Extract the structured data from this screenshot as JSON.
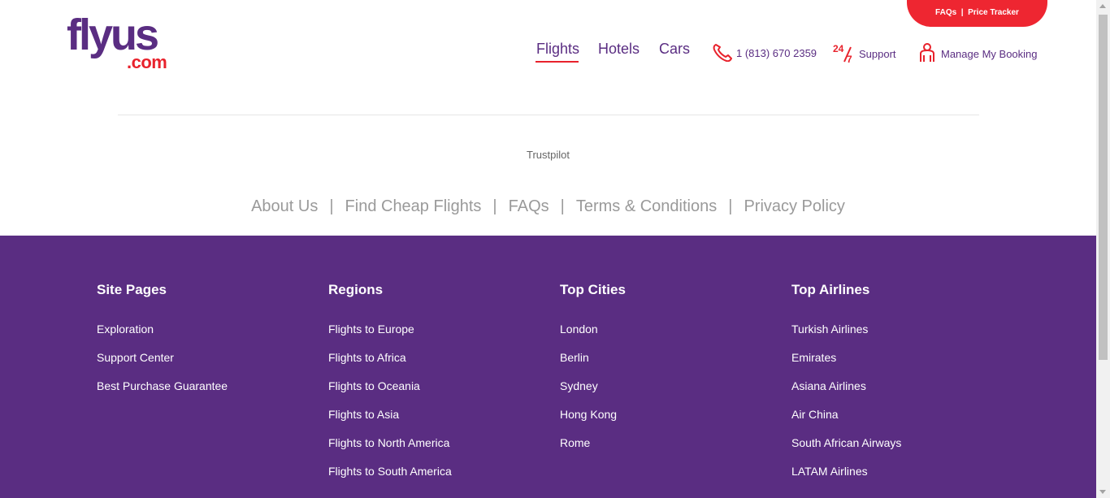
{
  "brand": {
    "logo_main": "flyus",
    "logo_suffix": ".com",
    "primary_color": "#5a2d82",
    "accent_color": "#e8222c"
  },
  "top_pill": {
    "faqs": "FAQs",
    "separator": "|",
    "price_tracker": "Price Tracker"
  },
  "nav": {
    "flights": "Flights",
    "hotels": "Hotels",
    "cars": "Cars",
    "active": "Flights"
  },
  "header": {
    "phone": "1 (813) 670 2359",
    "support_badge": "24/7",
    "support": "Support",
    "manage_booking": "Manage My Booking"
  },
  "trustpilot": "Trustpilot",
  "footer_links": {
    "about": "About Us",
    "cheap_flights": "Find Cheap Flights",
    "faqs": "FAQs",
    "terms": "Terms & Conditions",
    "privacy": "Privacy Policy",
    "separator": "|"
  },
  "footer": {
    "site_pages": {
      "title": "Site Pages",
      "items": [
        "Exploration",
        "Support Center",
        "Best Purchase Guarantee"
      ]
    },
    "regions": {
      "title": "Regions",
      "items": [
        "Flights to Europe",
        "Flights to Africa",
        "Flights to Oceania",
        "Flights to Asia",
        "Flights to North America",
        "Flights to South America"
      ]
    },
    "top_cities": {
      "title": "Top Cities",
      "items": [
        "London",
        "Berlin",
        "Sydney",
        "Hong Kong",
        "Rome"
      ]
    },
    "top_airlines": {
      "title": "Top Airlines",
      "items": [
        "Turkish Airlines",
        "Emirates",
        "Asiana Airlines",
        "Air China",
        "South African Airways",
        "LATAM Airlines"
      ]
    }
  },
  "icons": {
    "phone": "phone-icon",
    "support": "clock-24-7-icon",
    "manage": "person-icon"
  }
}
